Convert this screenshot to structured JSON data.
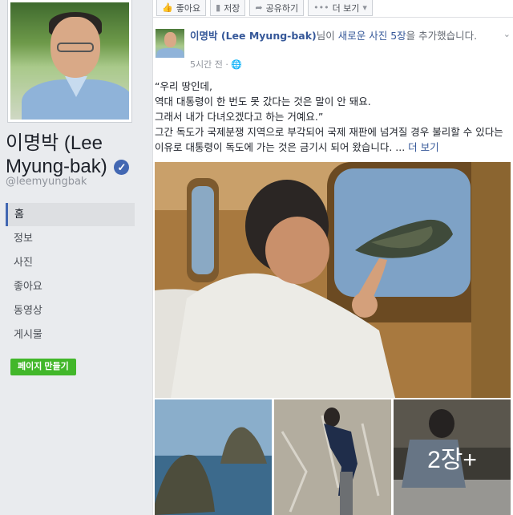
{
  "sidebar": {
    "page_name": "이명박 (Lee Myung-bak)",
    "username": "@leemyungbak",
    "nav": [
      {
        "label": "홈"
      },
      {
        "label": "정보"
      },
      {
        "label": "사진"
      },
      {
        "label": "좋아요"
      },
      {
        "label": "동영상"
      },
      {
        "label": "게시물"
      }
    ],
    "active_nav": "홈",
    "create_page_label": "페이지 만들기"
  },
  "action_bar": {
    "like_label": "좋아요",
    "save_label": "저장",
    "share_label": "공유하기",
    "more_label": "더 보기"
  },
  "post": {
    "author": "이명박 (Lee Myung-bak)",
    "action_prefix": "님이 ",
    "action_link": "새로운 사진 5장",
    "action_suffix": "을 추가했습니다.",
    "time": "5시간 전",
    "privacy_icon": "globe-icon",
    "quote_line1": "“우리 땅인데,",
    "quote_line2": "역대 대통령이 한 번도 못 갔다는 것은 말이 안 돼요.",
    "quote_line3": "그래서 내가 다녀오겠다고 하는 거예요.”",
    "body": "그간 독도가 국제분쟁 지역으로 부각되어 국제 재판에 넘겨질 경우 불리할 수 있다는 이유로 대통령이 독도에 가는 것은 금기시 되어 왔습니다.",
    "ellipsis": " ... ",
    "see_more": "더 보기",
    "more_photos_label": "2장+"
  },
  "colors": {
    "accent": "#4267b2",
    "link": "#365899",
    "create_button": "#42b72a"
  }
}
